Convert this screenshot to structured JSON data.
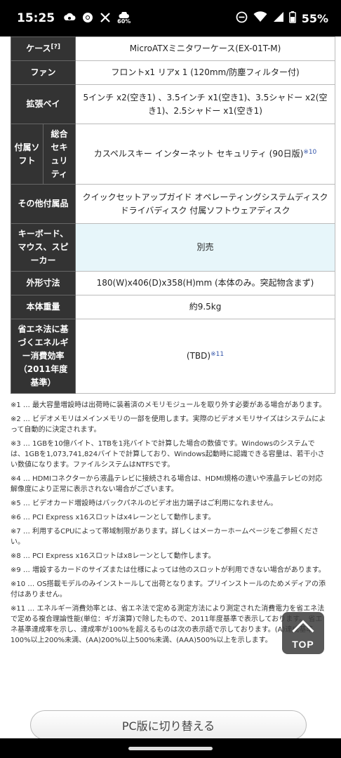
{
  "status_bar": {
    "time": "15:25",
    "battery": "55%",
    "icons": [
      "cloud-gear-icon",
      "chrome-icon",
      "x-icon",
      "weather-icon",
      "dnd-icon",
      "wifi-icon",
      "signal-icon",
      "battery-icon"
    ],
    "weather_text": "60%"
  },
  "spec_table": {
    "case": {
      "label": "ケース",
      "note": "[?]",
      "value": "MicroATXミニタワーケース(EX-01T-M)"
    },
    "fan": {
      "label": "ファン",
      "value": "フロントx1 リアx 1 (120mm/防塵フィルター付)"
    },
    "bays": {
      "label": "拡張ベイ",
      "value": "5インチ x2(空き1) 、3.5インチ x1(空き1)、3.5シャドー x2(空き1)、2.5シャドー x1(空き1)"
    },
    "software": {
      "label": "付属ソフト",
      "sublabel": "総合セキュリティ",
      "value": "カスペルスキー インターネット セキュリティ (90日版)",
      "note": "※10"
    },
    "accessories": {
      "label": "その他付属品",
      "value": "クイックセットアップガイド オペレーティングシステムディスク ドライバディスク 付属ソフトウェアディスク"
    },
    "keyboard": {
      "label": "キーボード、マウス、スピーカー",
      "value": "別売"
    },
    "dimensions": {
      "label": "外形寸法",
      "value": "180(W)x406(D)x358(H)mm (本体のみ。突起物含まず)"
    },
    "weight": {
      "label": "本体重量",
      "value": "約9.5kg"
    },
    "energy": {
      "label": "省エネ法に基づくエネルギー消費効率（2011年度基準）",
      "value": "(TBD)",
      "note": "※11"
    }
  },
  "notes": [
    "※1 … 最大容量増設時は出荷時に装着済のメモリモジュールを取り外す必要がある場合があります。",
    "※2 … ビデオメモリはメインメモリの一部を使用します。実際のビデオメモリサイズはシステムによって自動的に決定されます。",
    "※3 … 1GBを10億バイト、1TBを1兆バイトで計算した場合の数値です。Windowsのシステムでは、1GBを1,073,741,824バイトで計算しており、Windows起動時に認識できる容量は、若干小さい数値になります。ファイルシステムはNTFSです。",
    "※4 … HDMIコネクターから液晶テレビに接続される場合は、HDMI規格の違いや液晶テレビの対応解像度により正常に表示されない場合がございます。",
    "※5 … ビデオカード増設時はバックパネルのビデオ出力端子はご利用になれません。",
    "※6 … PCI Express x16スロットはx4レーンとして動作します。",
    "※7 … 利用するCPUによって帯域制限があります。詳しくはメーカーホームページをご参照ください。",
    "※8 … PCI Express x16スロットはx8レーンとして動作します。",
    "※9 … 増設するカードのサイズまたは仕様によっては他のスロットが利用できない場合があります。",
    "※10 … OS搭載モデルのみインストールして出荷となります。プリインストールのためメディアの添付はありません。",
    "※11 … エネルギー消費効率とは、省エネ法で定める測定方法により測定された消費電力を省エネ法で定める複合理論性能(単位：ギガ演算)で除したもので、2011年度基準で表示しております。 省エネ基準達成率を示し、達成率が100%を超えるものは次の表示語で示しております。(A)達成基準100%以上200%未満、(AA)200%以上500%未満、(AAA)500%以上を示します。"
  ],
  "top_button": {
    "label": "TOP"
  },
  "pc_switch_button": {
    "label": "PC版に切り替える"
  }
}
